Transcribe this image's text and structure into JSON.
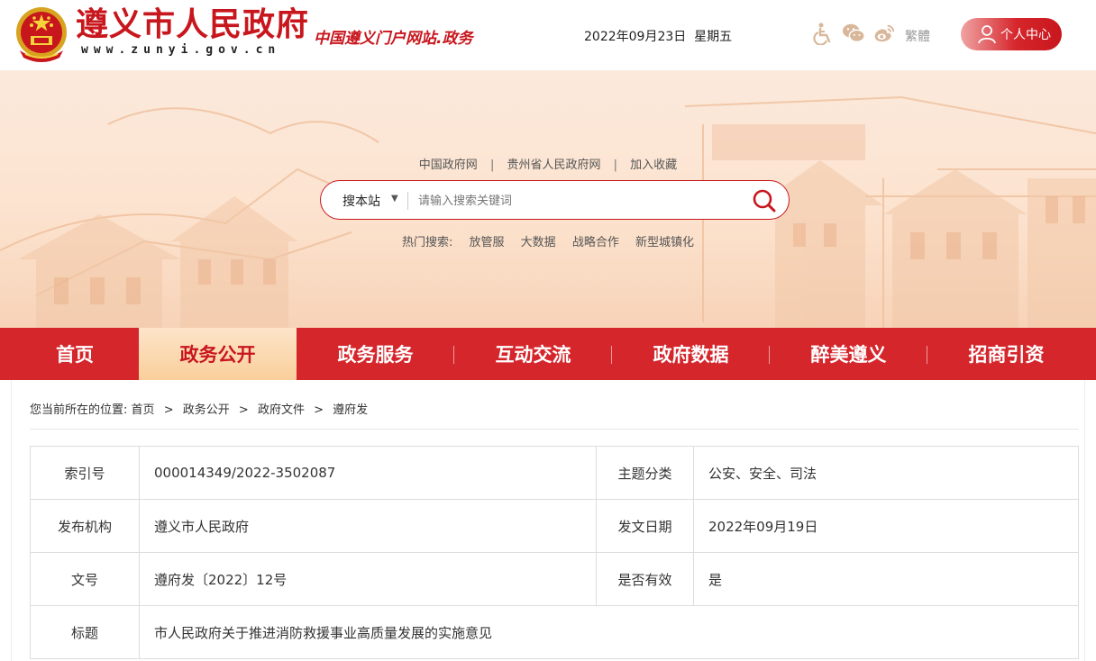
{
  "header": {
    "site_title": "遵义市人民政府",
    "site_url": "www.zunyi.gov.cn",
    "slogan": "中国遵义门户网站.政务",
    "date": "2022年09月23日",
    "weekday": "星期五",
    "tools": [
      {
        "icon": "accessibility-icon"
      },
      {
        "icon": "wechat-icon"
      },
      {
        "icon": "weibo-icon"
      }
    ],
    "traditional_label": "繁體",
    "user_center_label": "个人中心",
    "accent_color": "#c8161d"
  },
  "banner": {
    "quick_links": [
      "中国政府网",
      "贵州省人民政府网",
      "加入收藏"
    ],
    "search": {
      "scope": "搜本站",
      "placeholder": "请输入搜索关键词"
    },
    "hot_search_label": "热门搜索:",
    "hot_search_items": [
      "放管服",
      "大数据",
      "战略合作",
      "新型城镇化"
    ]
  },
  "nav": {
    "items": [
      "首页",
      "政务公开",
      "政务服务",
      "互动交流",
      "政府数据",
      "醉美遵义",
      "招商引资"
    ],
    "active_index": 1
  },
  "breadcrumb": {
    "prefix": "您当前所在的位置:",
    "items": [
      "首页",
      "政务公开",
      "政府文件",
      "遵府发"
    ]
  },
  "info": {
    "rows": [
      {
        "label": "索引号",
        "value": "000014349/2022-3502087",
        "label2": "主题分类",
        "value2": "公安、安全、司法"
      },
      {
        "label": "发布机构",
        "value": "遵义市人民政府",
        "label2": "发文日期",
        "value2": "2022年09月19日"
      },
      {
        "label": "文号",
        "value": "遵府发〔2022〕12号",
        "label2": "是否有效",
        "value2": "是"
      },
      {
        "label": "标题",
        "value": "市人民政府关于推进消防救援事业高质量发展的实施意见"
      }
    ]
  }
}
